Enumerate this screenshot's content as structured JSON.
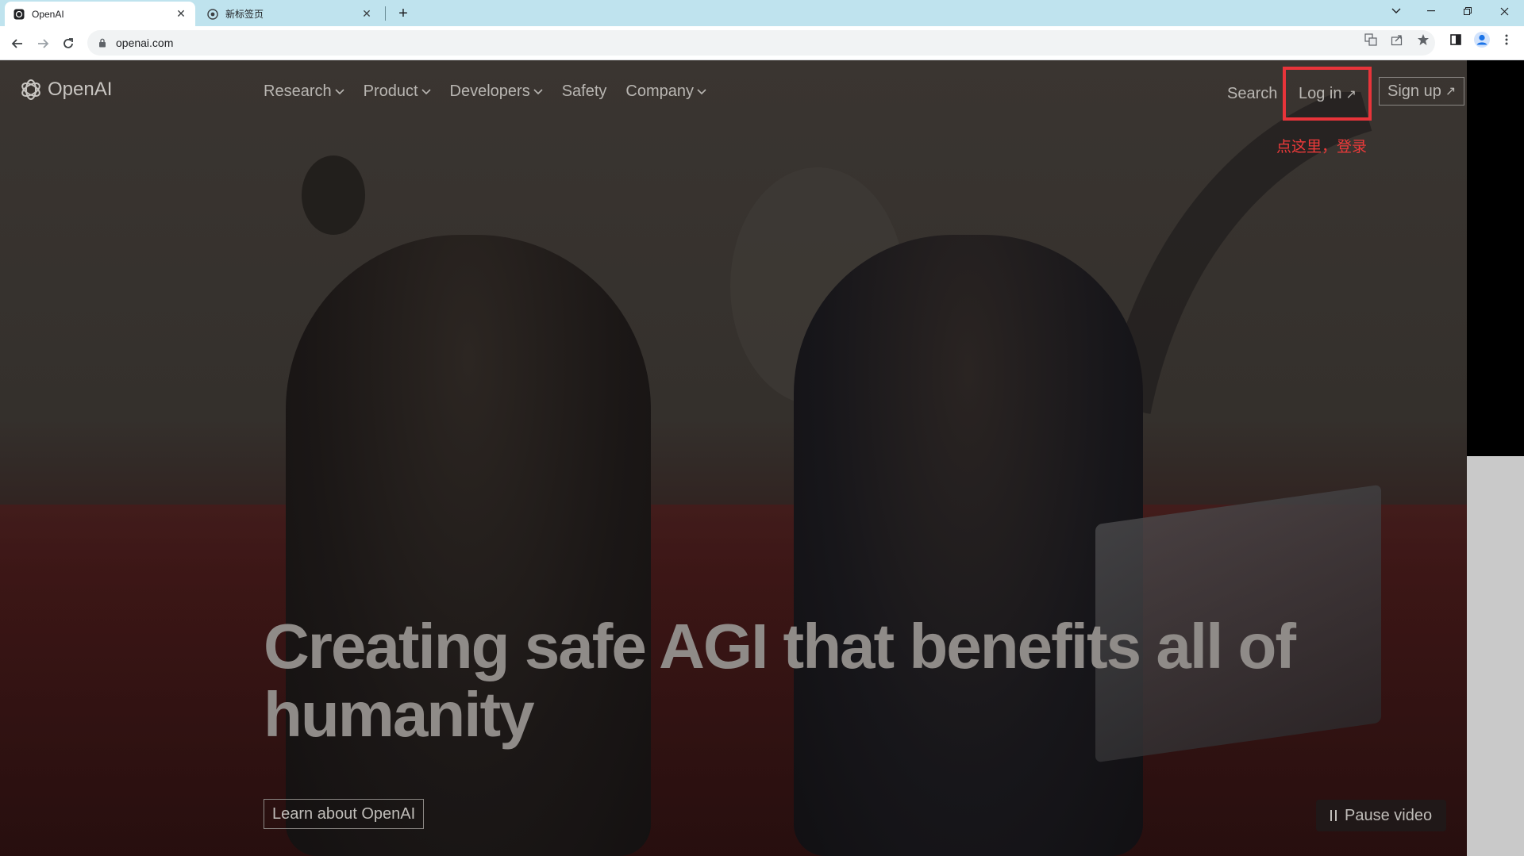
{
  "browser": {
    "tabs": [
      {
        "title": "OpenAI",
        "active": true
      },
      {
        "title": "新标签页",
        "active": false
      }
    ],
    "url": "openai.com"
  },
  "site": {
    "logo_text": "OpenAI",
    "nav": [
      {
        "label": "Research",
        "has_dropdown": true
      },
      {
        "label": "Product",
        "has_dropdown": true
      },
      {
        "label": "Developers",
        "has_dropdown": true
      },
      {
        "label": "Safety",
        "has_dropdown": false
      },
      {
        "label": "Company",
        "has_dropdown": true
      }
    ],
    "search_label": "Search",
    "login_label": "Log in",
    "signup_label": "Sign up",
    "hero_title": "Creating safe AGI that benefits all of humanity",
    "learn_button": "Learn about OpenAI",
    "pause_button": "Pause video"
  },
  "annotation": {
    "text": "点这里，登录",
    "color": "#e8343a"
  },
  "colors": {
    "tabbar": "#bfe3ee",
    "nav_text": "#b9b6b2",
    "hero_text": "#8f8b88"
  }
}
